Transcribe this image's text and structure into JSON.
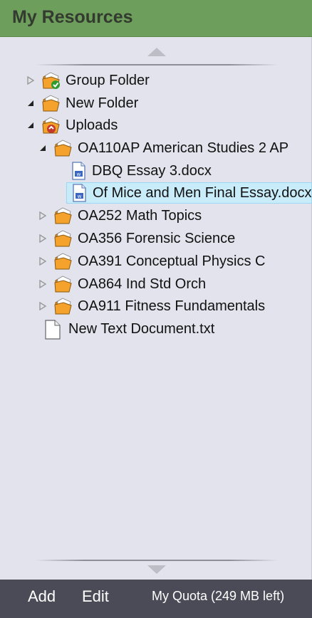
{
  "header": {
    "title": "My Resources"
  },
  "tree": {
    "group_folder": "Group Folder",
    "new_folder": "New Folder",
    "uploads": "Uploads",
    "oa110": "OA110AP American Studies 2 AP",
    "dbq": "DBQ Essay 3.docx",
    "mice": "Of Mice and Men Final Essay.docx",
    "oa252": "OA252 Math Topics",
    "oa356": "OA356 Forensic Science",
    "oa391": "OA391 Conceptual Physics C",
    "oa864": "OA864 Ind Std Orch",
    "oa911": "OA911 Fitness Fundamentals",
    "txt": "New Text Document.txt"
  },
  "footer": {
    "add_label": "Add",
    "edit_label": "Edit",
    "quota": "My Quota (249 MB left)"
  },
  "icons": {
    "group_folder": "shared-folder-icon",
    "folder": "folder-icon",
    "uploads_folder": "upload-folder-icon",
    "docx": "word-document-icon",
    "txt": "text-document-icon",
    "scroll_up": "scroll-up-arrow-icon",
    "scroll_down": "scroll-down-arrow-icon"
  },
  "colors": {
    "header_bg": "#6e9e5b",
    "panel_bg": "#e3e3ed",
    "selected_bg": "#c9ecfb",
    "footer_bg": "#4b4b58",
    "folder_orange": "#f4a22b"
  }
}
